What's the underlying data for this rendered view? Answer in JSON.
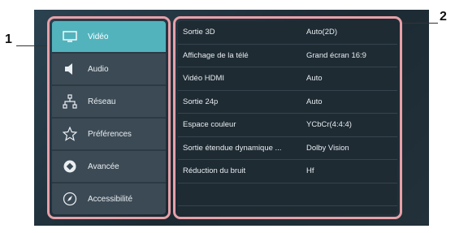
{
  "callouts": {
    "left": "1",
    "right": "2"
  },
  "menu": {
    "items": [
      {
        "label": "Vidéo",
        "icon": "monitor-icon",
        "active": true
      },
      {
        "label": "Audio",
        "icon": "speaker-icon",
        "active": false
      },
      {
        "label": "Réseau",
        "icon": "network-icon",
        "active": false
      },
      {
        "label": "Préférences",
        "icon": "star-icon",
        "active": false
      },
      {
        "label": "Avancée",
        "icon": "advanced-icon",
        "active": false
      },
      {
        "label": "Accessibilité",
        "icon": "compass-icon",
        "active": false
      }
    ]
  },
  "settings": {
    "rows": [
      {
        "label": "Sortie 3D",
        "value": "Auto(2D)"
      },
      {
        "label": "Affichage de la télé",
        "value": "Grand écran 16:9"
      },
      {
        "label": "Vidéo HDMI",
        "value": "Auto"
      },
      {
        "label": "Sortie 24p",
        "value": "Auto"
      },
      {
        "label": "Espace couleur",
        "value": "YCbCr(4:4:4)"
      },
      {
        "label": "Sortie étendue dynamique ...",
        "value": "Dolby Vision"
      },
      {
        "label": "Réduction du bruit",
        "value": "Hf"
      },
      {
        "label": "",
        "value": ""
      }
    ]
  },
  "colors": {
    "accent": "#52b3bd",
    "highlight_frame": "#e8a0a8"
  }
}
